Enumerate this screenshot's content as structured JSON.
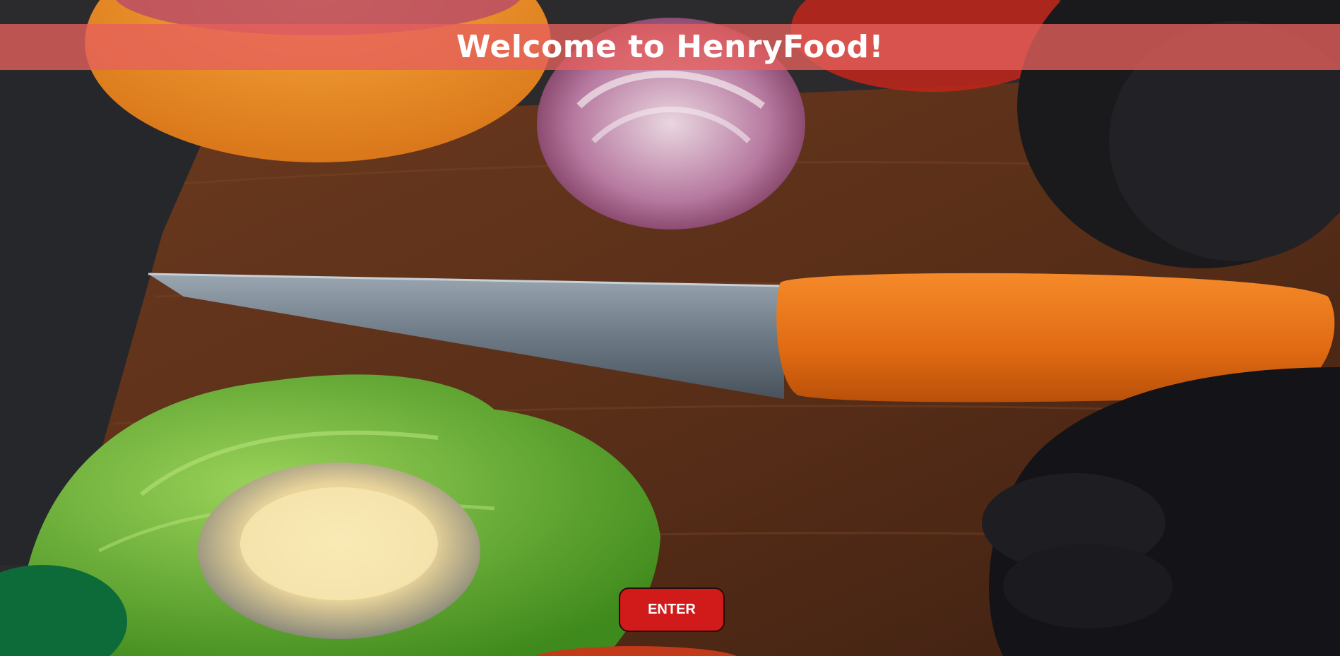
{
  "banner": {
    "title": "Welcome to HenryFood!"
  },
  "enter_button": {
    "label": "ENTER"
  },
  "background": {
    "image_subject": "cutting board with knife, lettuce, onion and gloved hands"
  },
  "colors": {
    "banner_overlay": "#e6605c",
    "button_fill": "#d11a1a",
    "button_text": "#ffffff",
    "title_text": "#ffffff"
  }
}
